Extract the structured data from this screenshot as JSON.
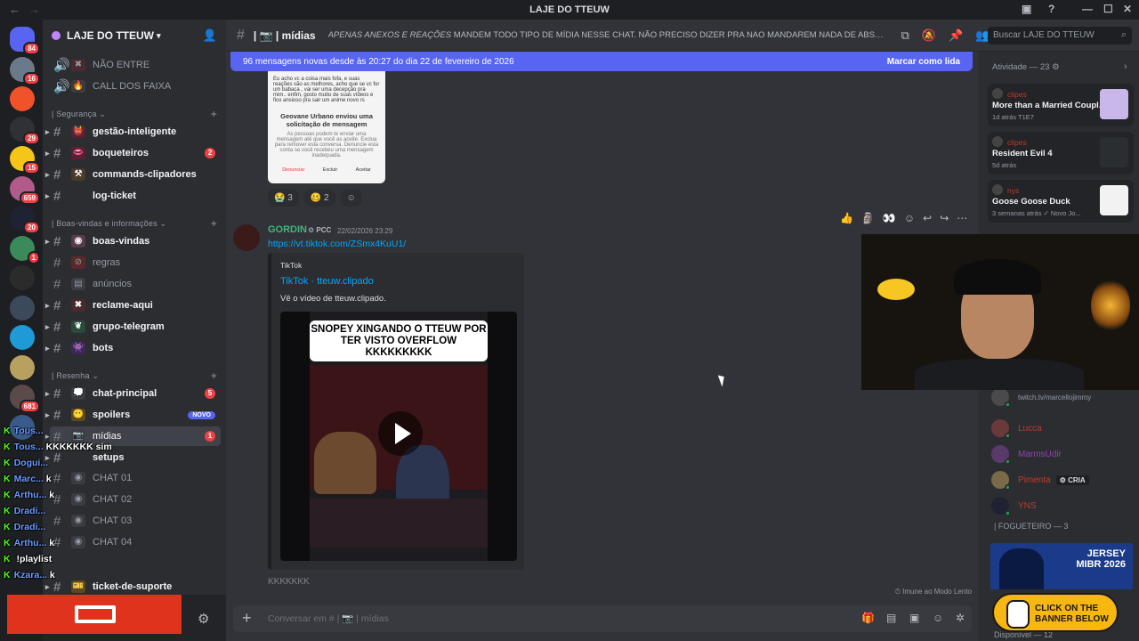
{
  "titlebar": {
    "title": "LAJE DO TTEUW"
  },
  "servers": [
    {
      "badge": "84",
      "color": "#5865f2"
    },
    {
      "badge": "16",
      "color": "#6b7a8a"
    },
    {
      "badge": "",
      "color": "#f0522a"
    },
    {
      "badge": "29",
      "color": "#2f3136"
    },
    {
      "badge": "15",
      "color": "#f5c518"
    },
    {
      "badge": "659",
      "color": "#b25b8a"
    },
    {
      "badge": "20",
      "color": "#1f2233"
    },
    {
      "badge": "1",
      "color": "#3a8a5a"
    },
    {
      "badge": "",
      "color": "#2b2b2b"
    },
    {
      "badge": "",
      "color": "#3b4a5a"
    },
    {
      "badge": "",
      "color": "#1e9ad6"
    },
    {
      "badge": "",
      "color": "#b8a060"
    },
    {
      "badge": "681",
      "color": "#5a4a4a"
    },
    {
      "badge": "",
      "color": "#3a5a8a"
    }
  ],
  "guild": {
    "name": "LAJE DO TTEUW"
  },
  "channels_top": [
    {
      "label": "NÃO ENTRE",
      "emoji": "❌"
    },
    {
      "label": "CALL DOS FAIXA",
      "emoji": "🔥"
    }
  ],
  "cat_seguranca": "| Segurança",
  "seguranca": [
    {
      "label": "gestão-inteligente",
      "badge": ""
    },
    {
      "label": "boqueteiros",
      "badge": "2"
    },
    {
      "label": "commands-clipadores",
      "badge": ""
    },
    {
      "label": "log-ticket",
      "badge": ""
    }
  ],
  "cat_boasvindas": "| Boas-vindas e informações",
  "boasvindas": [
    {
      "label": "boas-vindas"
    },
    {
      "label": "regras"
    },
    {
      "label": "anúncios"
    },
    {
      "label": "reclame-aqui"
    },
    {
      "label": "grupo-telegram"
    },
    {
      "label": "bots"
    }
  ],
  "cat_resenha": "| Resenha",
  "resenha": [
    {
      "label": "chat-principal",
      "badge": "5"
    },
    {
      "label": "spoilers",
      "badge": "NOVO"
    },
    {
      "label": "mídias",
      "badge": "1"
    },
    {
      "label": "setups",
      "badge": ""
    },
    {
      "label": "CHAT 01",
      "badge": ""
    },
    {
      "label": "CHAT 02",
      "badge": ""
    },
    {
      "label": "CHAT 03",
      "badge": ""
    },
    {
      "label": "CHAT 04",
      "badge": ""
    }
  ],
  "ticket_channel": "ticket-de-suporte",
  "chat_header": {
    "channel": "mídias",
    "topic_italic": "APENAS ANEXOS E REAÇÕES",
    "topic_rest": " MANDEM TODO TIPO DE MÍDIA NESSE CHAT. NÃO PRECISO DIZER PRA NAO MANDAREM NADA DE ABSURDO NÉ? RESP..."
  },
  "search": {
    "placeholder": "Buscar LAJE DO TTEUW"
  },
  "banner": {
    "text": "96 mensagens novas desde às 20:27 do dia 22 de fevereiro de 2026",
    "action": "Marcar como lida"
  },
  "screenshot_msg": {
    "body": "Eu acho vc a coisa mais fofa, e suas reações são as melhores, acho que se vc for um babaca , vai ser uma decepção pra mim.. enfim, gosto muito de suas vídeos e fico ansioso pra sair um anime novo rs",
    "title": "Geovane Urbano enviou uma solicitação de mensagem",
    "sub": "As pessoas podem te enviar uma mensagem até que você as aceite. Exclua para remover esta conversa. Denuncie esta conta se você recebeu uma mensagem inadequada.",
    "actions": [
      "Denunciar",
      "Excluir",
      "Aceitar"
    ]
  },
  "reactions": [
    {
      "emoji": "😭",
      "count": "3"
    },
    {
      "emoji": "🥴",
      "count": "2"
    }
  ],
  "message": {
    "author": "GORDIN",
    "tag": "PCC",
    "time": "22/02/2026 23:29",
    "link": "https://vt.tiktok.com/ZSmx4KuU1/",
    "embed_provider": "TikTok",
    "embed_title": "TikTok · tteuw.clipado",
    "embed_desc": "Vê o vídeo de tteuw.clipado.",
    "video_caption": "SNOPEY XINGANDO O TTEUW POR TER VISTO OVERFLOW KKKKKKKKK",
    "after": "KKKKKKK"
  },
  "slowmode": "Imune ao Modo Lento",
  "composer": {
    "placeholder": "Conversar em # | 📷 | mídias"
  },
  "activity": {
    "header": "Atividade — 23",
    "cards": [
      {
        "who": "clipes",
        "title": "More than a Married Coupl...",
        "meta": "1d atrás  T1E7",
        "thumb": "#c8b7e8"
      },
      {
        "who": "clipes",
        "title": "Resident Evil 4",
        "meta": "5d atrás",
        "thumb": "#2a2e30"
      },
      {
        "who": "nys",
        "title": "Goose Goose Duck",
        "meta": "3 semanas atrás  ✓ Novo Jo...",
        "thumb": "#f2f2f2"
      }
    ]
  },
  "members": [
    {
      "name": "twitch.tv/marcellojimmy",
      "color": "#949ba4"
    },
    {
      "name": "Lucca",
      "color": "#c0392b"
    },
    {
      "name": "MarmsUdir",
      "color": "#8e44ad"
    },
    {
      "name": "Pimenta",
      "color": "#c0392b",
      "tag": "CRIA"
    },
    {
      "name": "YNS",
      "color": "#c0392b"
    }
  ],
  "section_fogueteiro": "| FOGUETEIRO — 3",
  "available": "Disponível — 12",
  "ad": {
    "line1": "JERSEY",
    "line2": "MIBR 2026"
  },
  "cta": {
    "text": "CLICK ON THE BANNER BELOW"
  },
  "overlay_chat": [
    {
      "name": "Tous...",
      "text": ""
    },
    {
      "name": "Tous...",
      "text": "KKKKKKK sim"
    },
    {
      "name": "Dogui...",
      "text": ""
    },
    {
      "name": "Marc...",
      "text": "k"
    },
    {
      "name": "Arthu...",
      "text": "k"
    },
    {
      "name": "Dradi...",
      "text": ""
    },
    {
      "name": "Dradi...",
      "text": ""
    },
    {
      "name": "Arthu...",
      "text": "k"
    },
    {
      "name": "",
      "text": "!playlist"
    },
    {
      "name": "Kzara...",
      "text": "k"
    }
  ]
}
